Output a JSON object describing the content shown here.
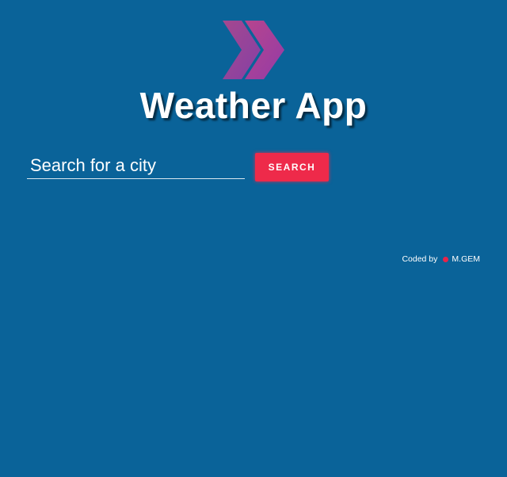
{
  "app": {
    "title": "Weather App",
    "accent_color": "#ee2a4a",
    "background_color": "#0a6399",
    "logo_icon": "double-chevron-right-icon"
  },
  "search": {
    "placeholder": "Search for a city",
    "value": "",
    "button_label": "SEARCH"
  },
  "footer": {
    "credit_prefix": "Coded by",
    "credit_icon": "heart-icon",
    "credit_name": "M.GEM"
  }
}
